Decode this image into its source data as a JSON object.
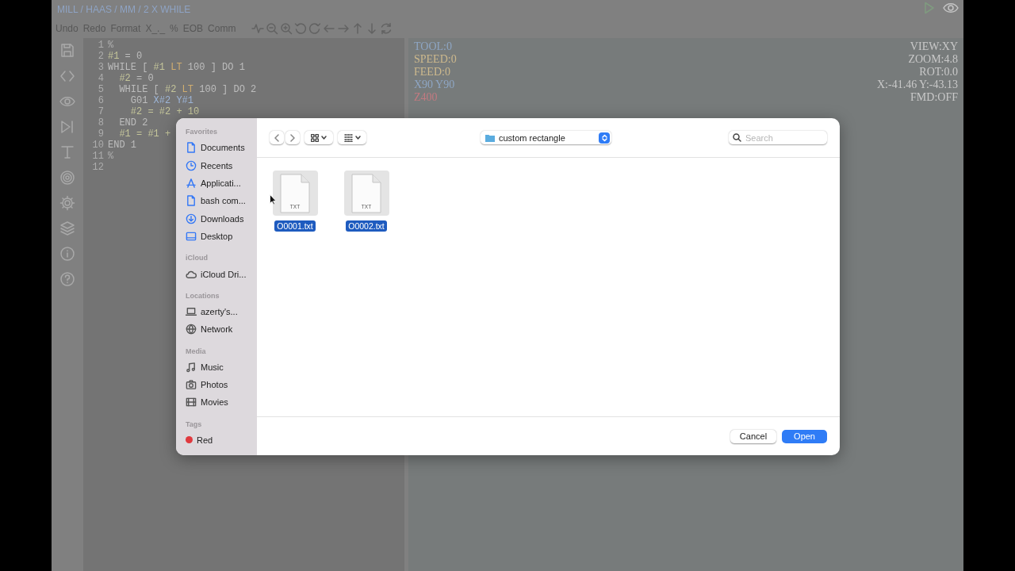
{
  "breadcrumb": "MILL / HAAS / MM / 2 X WHILE",
  "toolbar": {
    "buttons": [
      "Undo",
      "Redo",
      "Format",
      "X_._",
      "%",
      "EOB",
      "Comm"
    ]
  },
  "editor": {
    "lines": [
      {
        "number": "1",
        "tokens": [
          {
            "text": "%",
            "kind": "comment"
          }
        ]
      },
      {
        "number": "2",
        "tokens": [
          {
            "text": "#1",
            "kind": "var"
          },
          {
            "text": " = 0",
            "kind": "plain"
          }
        ]
      },
      {
        "number": "3",
        "tokens": [
          {
            "text": "WHILE [ ",
            "kind": "plain"
          },
          {
            "text": "#1",
            "kind": "var"
          },
          {
            "text": " LT",
            "kind": "op"
          },
          {
            "text": " 100 ] DO 1",
            "kind": "plain"
          }
        ]
      },
      {
        "number": "4",
        "tokens": [
          {
            "text": "  #2",
            "kind": "var"
          },
          {
            "text": " = 0",
            "kind": "plain"
          }
        ]
      },
      {
        "number": "5",
        "tokens": [
          {
            "text": "  WHILE [ ",
            "kind": "plain"
          },
          {
            "text": "#2",
            "kind": "var"
          },
          {
            "text": " LT",
            "kind": "op"
          },
          {
            "text": " 100 ] DO 2",
            "kind": "plain"
          }
        ]
      },
      {
        "number": "6",
        "tokens": [
          {
            "text": "    G01 ",
            "kind": "plain"
          },
          {
            "text": "X#2 Y#1",
            "kind": "axis"
          }
        ]
      },
      {
        "number": "7",
        "tokens": [
          {
            "text": "    #2 = #2 + 10",
            "kind": "var"
          }
        ]
      },
      {
        "number": "8",
        "tokens": [
          {
            "text": "  END 2",
            "kind": "plain"
          }
        ]
      },
      {
        "number": "9",
        "tokens": [
          {
            "text": "  #1 = #1 +",
            "kind": "var"
          }
        ]
      },
      {
        "number": "10",
        "tokens": [
          {
            "text": "END 1",
            "kind": "plain"
          }
        ]
      },
      {
        "number": "11",
        "tokens": [
          {
            "text": "%",
            "kind": "comment"
          }
        ]
      },
      {
        "number": "12"
      }
    ]
  },
  "viewport": {
    "left": [
      {
        "text": "TOOL:0",
        "color": "#8ea6c4"
      },
      {
        "text": "SPEED:0",
        "color": "#cdb98d"
      },
      {
        "text": "FEED:0",
        "color": "#cdb98d"
      },
      {
        "text": "X90 Y90",
        "color": "#8ea6c4"
      },
      {
        "text": "Z400",
        "color": "#c27a80"
      }
    ],
    "right": [
      "VIEW:XY",
      "ZOOM:4.8",
      "ROT:0.0",
      "X:-41.46 Y:-43.13",
      "FMD:OFF"
    ]
  },
  "dialog": {
    "sidebar": [
      {
        "title": "Favorites",
        "items": [
          {
            "label": "Documents",
            "kind": "document"
          },
          {
            "label": "Recents",
            "kind": "clock"
          },
          {
            "label": "Applicati...",
            "kind": "apps"
          },
          {
            "label": "bash com...",
            "kind": "document"
          },
          {
            "label": "Downloads",
            "kind": "download"
          },
          {
            "label": "Desktop",
            "kind": "desktop"
          }
        ]
      },
      {
        "title": "iCloud",
        "items": [
          {
            "label": "iCloud Dri...",
            "kind": "cloud"
          }
        ]
      },
      {
        "title": "Locations",
        "items": [
          {
            "label": "azerty's...",
            "kind": "laptop"
          },
          {
            "label": "Network",
            "kind": "network"
          }
        ]
      },
      {
        "title": "Media",
        "items": [
          {
            "label": "Music",
            "kind": "music"
          },
          {
            "label": "Photos",
            "kind": "camera"
          },
          {
            "label": "Movies",
            "kind": "film"
          }
        ]
      },
      {
        "title": "Tags",
        "items": [
          {
            "label": "Red",
            "kind": "tag",
            "color": "#e0393e"
          }
        ]
      }
    ],
    "location": "custom rectangle",
    "search": {
      "placeholder": "Search"
    },
    "files": [
      {
        "name": "O0001.txt",
        "badge": "TXT",
        "selected": true
      },
      {
        "name": "O0002.txt",
        "badge": "TXT",
        "selected": true
      }
    ],
    "buttons": [
      {
        "label": "Cancel",
        "kind": "secondary"
      },
      {
        "label": "Open",
        "kind": "primary"
      }
    ]
  }
}
